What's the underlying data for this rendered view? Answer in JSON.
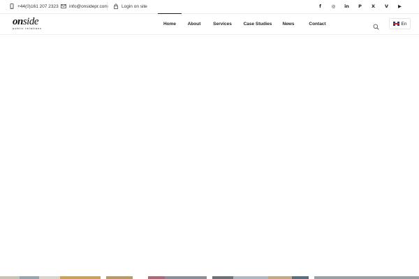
{
  "topbar": {
    "phone": "+44(0)161 207 2323",
    "email": "info@onsidepr.com",
    "login": "Login on site"
  },
  "social": [
    {
      "icon": "facebook-icon",
      "glyph": "f"
    },
    {
      "icon": "instagram-icon",
      "glyph": "◎"
    },
    {
      "icon": "linkedin-icon",
      "glyph": "in"
    },
    {
      "icon": "pinterest-icon",
      "glyph": "P"
    },
    {
      "icon": "x-icon",
      "glyph": "X"
    },
    {
      "icon": "vimeo-icon",
      "glyph": "V"
    },
    {
      "icon": "youtube-icon",
      "glyph": "▶"
    }
  ],
  "logo": {
    "word_on": "on",
    "word_side": "side",
    "tagline": "public relations"
  },
  "nav": [
    {
      "label": "Home",
      "active": true
    },
    {
      "label": "About",
      "active": false
    },
    {
      "label": "Services",
      "active": false
    },
    {
      "label": "Case Studies",
      "active": false
    },
    {
      "label": "News",
      "active": false
    },
    {
      "label": "Contact",
      "active": false
    }
  ],
  "language": {
    "label": "En",
    "flag": "uk-flag-icon"
  },
  "colors": {
    "text": "#222222",
    "active_indicator": "#222222",
    "flag_blue": "#1d3a8a",
    "flag_red": "#d3242b"
  }
}
